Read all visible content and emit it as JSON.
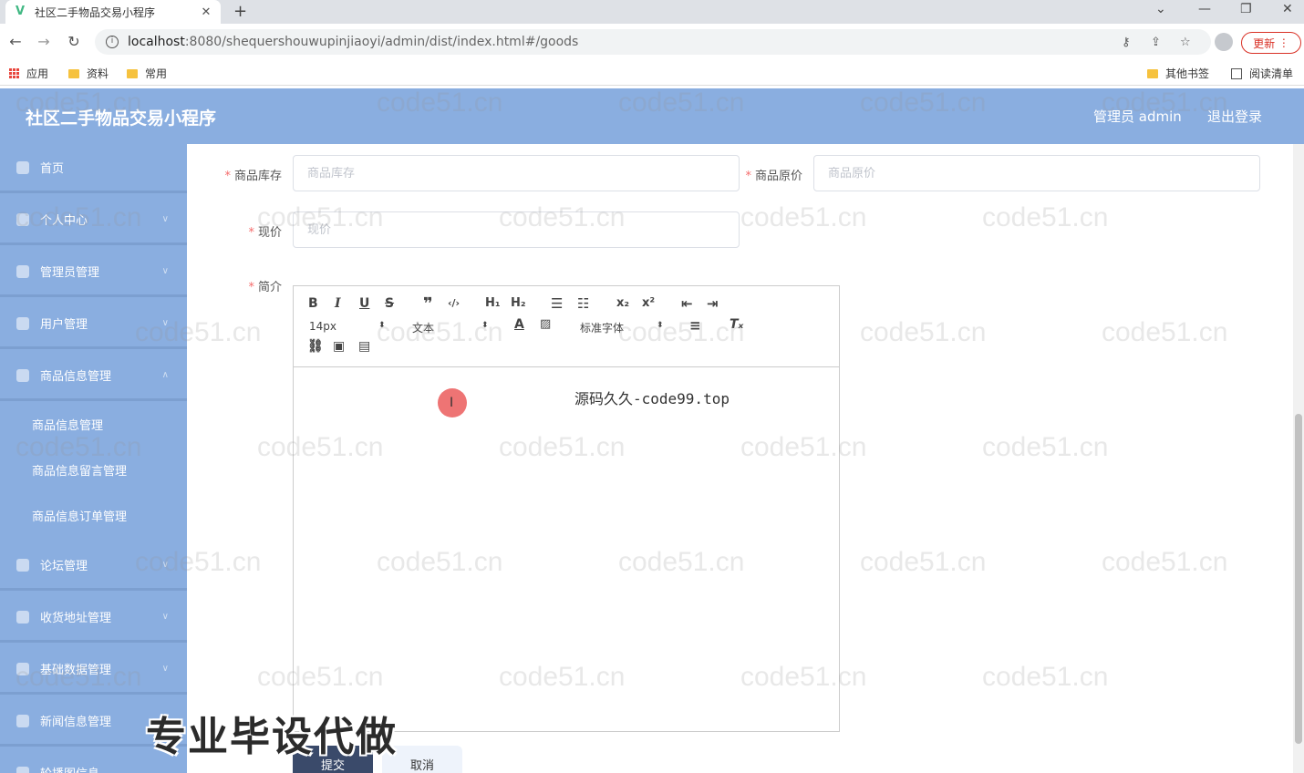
{
  "browser": {
    "tab_title": "社区二手物品交易小程序",
    "url_host": "localhost",
    "url_rest": ":8080/shequershouwupinjiaoyi/admin/dist/index.html#/goods",
    "update_label": "更新",
    "bookmarks": [
      "应用",
      "资料",
      "常用"
    ],
    "bookmarks_right": [
      "其他书签",
      "阅读清单"
    ]
  },
  "header": {
    "title": "社区二手物品交易小程序",
    "user": "管理员 admin",
    "logout": "退出登录"
  },
  "sidebar": {
    "items": [
      {
        "label": "首页"
      },
      {
        "label": "个人中心"
      },
      {
        "label": "管理员管理"
      },
      {
        "label": "用户管理"
      },
      {
        "label": "商品信息管理"
      },
      {
        "label": "论坛管理"
      },
      {
        "label": "收货地址管理"
      },
      {
        "label": "基础数据管理"
      },
      {
        "label": "新闻信息管理"
      },
      {
        "label": "轮播图信息"
      }
    ],
    "sub_items": [
      {
        "label": "商品信息管理"
      },
      {
        "label": "商品信息留言管理"
      },
      {
        "label": "商品信息订单管理"
      }
    ]
  },
  "form": {
    "stock_label": "商品库存",
    "stock_placeholder": "商品库存",
    "original_price_label": "商品原价",
    "original_price_placeholder": "商品原价",
    "current_price_label": "现价",
    "current_price_placeholder": "现价",
    "intro_label": "简介",
    "required_mark": "*"
  },
  "editor": {
    "font_size": "14px",
    "paragraph": "文本",
    "font_family": "标准字体",
    "content": "源码久久-code99.top"
  },
  "buttons": {
    "submit": "提交",
    "cancel": "取消"
  },
  "overlay": "专业毕设代做",
  "watermark": "code51.cn"
}
